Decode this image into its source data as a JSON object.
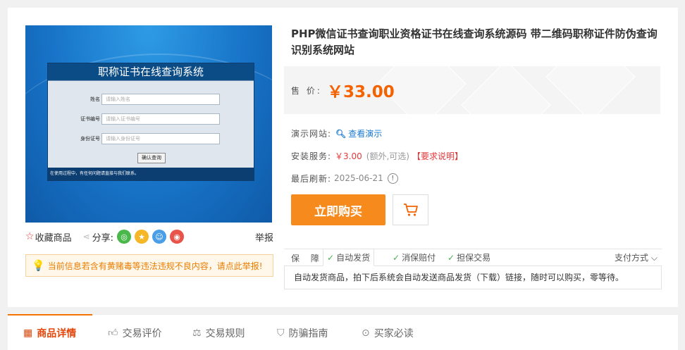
{
  "preview": {
    "form_title": "职称证书在线查询系统",
    "fields": [
      {
        "label": "姓名",
        "placeholder": "请输入姓名"
      },
      {
        "label": "证书编号",
        "placeholder": "请输入证书编号"
      },
      {
        "label": "身份证号",
        "placeholder": "请输入身份证号"
      }
    ],
    "submit_label": "确认查询",
    "footer_text": "在使用过程中，有任何问题请直接与我们联系。"
  },
  "actions": {
    "favorite_label": "收藏商品",
    "share_label": "分享:",
    "share_targets": [
      {
        "icon": "wechat-icon",
        "glyph": "◎",
        "color": "#4bb84b"
      },
      {
        "icon": "qzone-icon",
        "glyph": "★",
        "color": "#f5b627"
      },
      {
        "icon": "qq-icon",
        "glyph": "☺",
        "color": "#4a9ee8"
      },
      {
        "icon": "weibo-icon",
        "glyph": "◉",
        "color": "#e8534a"
      }
    ],
    "report_label": "举报"
  },
  "notice": {
    "text": "当前信息若含有黄赌毒等违法违规不良内容，请点此举报!"
  },
  "product": {
    "title": "PHP微信证书查询职业资格证书在线查询系统源码 带二维码职称证件防伪查询识别系统网站",
    "price_label": "售 价:",
    "price": "￥33.00",
    "demo_label": "演示网站:",
    "demo_link": "查看演示",
    "install_label": "安装服务:",
    "install_fee": "￥3.00",
    "install_note": "(额外,可选)",
    "install_link": "【要求说明】",
    "refresh_label": "最后刷新:",
    "refresh_date": "2025-06-21",
    "buy_label": "立即购买"
  },
  "guarantee": {
    "label": "保 障:",
    "items": [
      "自动发货",
      "消保赔付",
      "担保交易"
    ],
    "payment_label": "支付方式",
    "description": "自动发货商品，拍下后系统会自动发送商品发货（下载）链接，随时可以购买，零等待。"
  },
  "tabs": [
    {
      "label": "商品详情",
      "icon": "details-icon",
      "active": true
    },
    {
      "label": "交易评价",
      "icon": "thumbs-up-icon",
      "active": false
    },
    {
      "label": "交易规则",
      "icon": "scale-icon",
      "active": false
    },
    {
      "label": "防骗指南",
      "icon": "shield-icon",
      "active": false
    },
    {
      "label": "买家必读",
      "icon": "info-icon",
      "active": false
    }
  ],
  "colors": {
    "accent": "#f78a1d",
    "price": "#f56200",
    "alert": "#e4393c",
    "link": "#1a7bd0"
  }
}
